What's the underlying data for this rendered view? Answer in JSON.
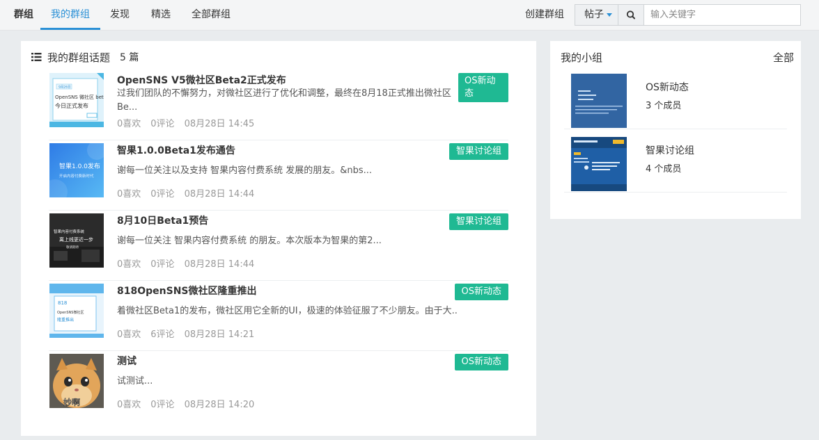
{
  "nav": {
    "brand": "群组",
    "items": [
      "我的群组",
      "发现",
      "精选",
      "全部群组"
    ],
    "create_group": "创建群组",
    "search_type": "帖子",
    "search_placeholder": "输入关键字"
  },
  "main": {
    "title": "我的群组话题",
    "count": "5 篇",
    "posts": [
      {
        "title": "OpenSNS V5微社区Beta2正式发布",
        "summary": "过我们团队的不懈努力，对微社区进行了优化和调整，最终在8月18正式推出微社区Be...",
        "likes": "0喜欢",
        "comments": "0评论",
        "time": "08月28日 14:45",
        "tag": "OS新动态",
        "thumb_lines": [
          "OpenSNS 微社区 beta2",
          "今日正式发布"
        ],
        "thumb_chip": "9月26日"
      },
      {
        "title": "智果1.0.0Beta1发布通告",
        "summary": "谢每一位关注以及支持 智果内容付费系统 发展的朋友。&nbs...",
        "likes": "0喜欢",
        "comments": "0评论",
        "time": "08月28日 14:44",
        "tag": "智果讨论组",
        "thumb_lines": [
          "智果1.0.0发布",
          "开启内容付费新时代"
        ]
      },
      {
        "title": "8月10日Beta1预告",
        "summary": "谢每一位关注 智果内容付费系统 的朋友。本次版本为智果的第2...",
        "likes": "0喜欢",
        "comments": "0评论",
        "time": "08月28日 14:44",
        "tag": "智果讨论组",
        "thumb_lines": [
          "智果内容付费系统",
          "离上线更近一步",
          "敬请期待"
        ]
      },
      {
        "title": "818OpenSNS微社区隆重推出",
        "summary": "着微社区Beta1的发布，微社区用它全新的UI，极速的体验征服了不少朋友。由于大...",
        "likes": "0喜欢",
        "comments": "6评论",
        "time": "08月28日 14:21",
        "tag": "OS新动态",
        "thumb_lines": [
          "818",
          "OpenSNS微社区",
          "隆重推出"
        ]
      },
      {
        "title": "测试",
        "summary": "试测试...",
        "likes": "0喜欢",
        "comments": "0评论",
        "time": "08月28日 14:20",
        "tag": "OS新动态",
        "thumb_lines": [
          "妙啊"
        ]
      }
    ]
  },
  "side": {
    "title": "我的小组",
    "all_link": "全部",
    "groups": [
      {
        "name": "OS新动态",
        "members": "3 个成员"
      },
      {
        "name": "智果讨论组",
        "members": "4 个成员"
      }
    ]
  },
  "colors": {
    "accent": "#2a90d6",
    "tag": "#1fb993",
    "page_bg": "#e9ecee"
  }
}
